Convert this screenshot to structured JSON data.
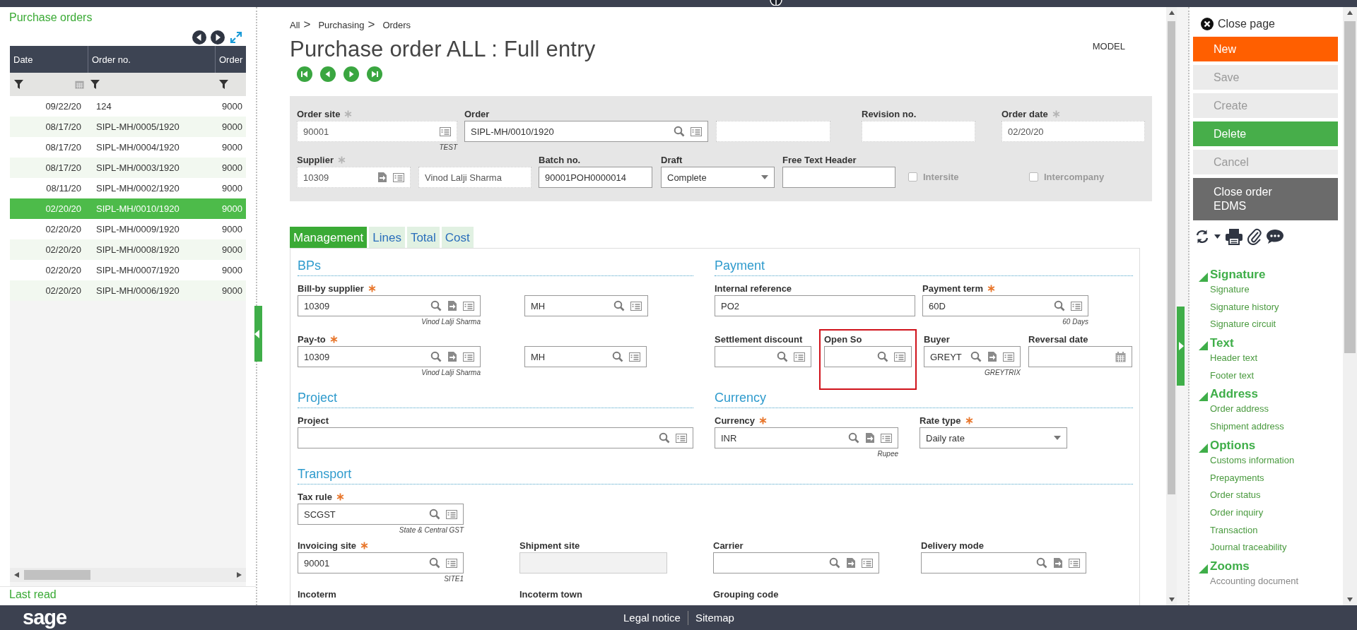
{
  "list_panel": {
    "title": "Purchase orders",
    "columns": [
      "Date",
      "Order no.",
      "Order"
    ],
    "rows": [
      {
        "date": "09/22/20",
        "order_no": "124",
        "column_3": "9000",
        "selected": false
      },
      {
        "date": "08/17/20",
        "order_no": "SIPL-MH/0005/1920",
        "column_3": "9000",
        "selected": false
      },
      {
        "date": "08/17/20",
        "order_no": "SIPL-MH/0004/1920",
        "column_3": "9000",
        "selected": false
      },
      {
        "date": "08/17/20",
        "order_no": "SIPL-MH/0003/1920",
        "column_3": "9000",
        "selected": false
      },
      {
        "date": "08/11/20",
        "order_no": "SIPL-MH/0002/1920",
        "column_3": "9000",
        "selected": false
      },
      {
        "date": "02/20/20",
        "order_no": "SIPL-MH/0010/1920",
        "column_3": "9000",
        "selected": true
      },
      {
        "date": "02/20/20",
        "order_no": "SIPL-MH/0009/1920",
        "column_3": "9000",
        "selected": false
      },
      {
        "date": "02/20/20",
        "order_no": "SIPL-MH/0008/1920",
        "column_3": "9000",
        "selected": false
      },
      {
        "date": "02/20/20",
        "order_no": "SIPL-MH/0007/1920",
        "column_3": "9000",
        "selected": false
      },
      {
        "date": "02/20/20",
        "order_no": "SIPL-MH/0006/1920",
        "column_3": "9000",
        "selected": false
      }
    ],
    "footer": "Last read"
  },
  "breadcrumb": [
    {
      "label": "All",
      "separator": ">"
    },
    {
      "label": "Purchasing",
      "separator": ">"
    },
    {
      "label": "Orders"
    }
  ],
  "page_title": "Purchase order ALL : Full entry",
  "mode_label": "MODEL",
  "header_rows": [
    [
      {
        "label": "Order site",
        "required": true,
        "value": "90001",
        "hint": "TEST",
        "kind": "detail",
        "readonly": true
      },
      {
        "label": "Order",
        "required": false,
        "value": "SIPL-MH/0010/1920",
        "kind": "lookup",
        "readonly": false
      },
      {
        "required": false,
        "kind": "text",
        "readonly": true
      },
      {
        "label": "Revision no.",
        "required": false,
        "kind": "text",
        "readonly": true
      },
      {
        "label": "Order date",
        "required": true,
        "value": "02/20/20",
        "kind": "text",
        "readonly": true
      }
    ],
    [
      {
        "label": "Supplier",
        "required": true,
        "value": "10309",
        "kind": "jump-detail",
        "readonly": true
      },
      {
        "required": false,
        "value": "Vinod Lalji Sharma",
        "kind": "text",
        "readonly": true
      },
      {
        "label": "Batch no.",
        "required": false,
        "value": "90001POH0000014",
        "kind": "text",
        "readonly": false
      },
      {
        "label": "Draft",
        "required": false,
        "value": "Complete",
        "kind": "select",
        "readonly": false
      },
      {
        "label": "Free Text Header",
        "required": false,
        "kind": "text",
        "readonly": false
      },
      {
        "label": "Intersite",
        "kind": "checkbox",
        "checked": false,
        "disabled": true
      },
      {
        "label": "Intercompany",
        "kind": "checkbox",
        "checked": false,
        "disabled": true
      }
    ]
  ],
  "tabs": [
    {
      "label": "Management",
      "selected": true
    },
    {
      "label": "Lines",
      "selected": false
    },
    {
      "label": "Total",
      "selected": false
    },
    {
      "label": "Cost",
      "selected": false
    }
  ],
  "sections": [
    {
      "title": "BPs",
      "rows": [
        [
          {
            "label": "Bill-by supplier",
            "required": true,
            "value": "10309",
            "hint": "Vinod Lalji Sharma",
            "kind": "lookup-jump"
          },
          {
            "value": "MH",
            "kind": "lookup"
          }
        ],
        [
          {
            "label": "Pay-to",
            "required": true,
            "value": "10309",
            "hint": "Vinod Lalji Sharma",
            "kind": "lookup-jump"
          },
          {
            "value": "MH",
            "kind": "lookup"
          }
        ]
      ]
    },
    {
      "title": "Payment",
      "rows": [
        [
          {
            "label": "Internal reference",
            "required": false,
            "value": "PO2",
            "kind": "text"
          },
          "",
          {
            "label": "Payment term",
            "required": true,
            "value": "60D",
            "hint": "60 Days",
            "kind": "lookup"
          }
        ],
        [
          {
            "label": "Settlement discount",
            "required": false,
            "kind": "lookup"
          },
          {
            "label": "Open So",
            "required": false,
            "kind": "lookup",
            "highlighted": true
          },
          {
            "label": "Buyer",
            "required": false,
            "value": "GREYT",
            "hint": "GREYTRIX",
            "kind": "lookup-jump"
          },
          {
            "label": "Reversal date",
            "required": false,
            "kind": "date"
          }
        ]
      ]
    },
    {
      "title": "Project",
      "rows": [
        [
          {
            "label": "Project",
            "required": false,
            "kind": "lookup"
          }
        ]
      ]
    },
    {
      "title": "Currency",
      "rows": [
        [
          {
            "label": "Currency",
            "required": true,
            "value": "INR",
            "hint": "Rupee",
            "kind": "lookup-jump"
          },
          {
            "label": "Rate type",
            "required": true,
            "value": "Daily rate",
            "kind": "select"
          }
        ]
      ]
    },
    {
      "title": "Transport",
      "rows": [
        [
          {
            "label": "Tax rule",
            "required": true,
            "value": "SCGST",
            "hint": "State & Central GST",
            "kind": "lookup"
          }
        ],
        [
          {
            "label": "Invoicing site",
            "required": true,
            "value": "90001",
            "hint": "SITE1",
            "kind": "lookup"
          },
          {
            "label": "Shipment site",
            "required": false,
            "kind": "text",
            "disabled": true
          },
          {
            "label": "Carrier",
            "required": false,
            "kind": "lookup-jump"
          },
          {
            "label": "Delivery mode",
            "required": false,
            "kind": "lookup-jump"
          }
        ],
        [
          {
            "label": "Incoterm",
            "required": false
          },
          {
            "label": "Incoterm town",
            "required": false
          },
          {
            "label": "Grouping code",
            "required": false
          }
        ]
      ]
    }
  ],
  "actions": {
    "close_label": "Close page",
    "buttons": [
      {
        "lines": [
          "New"
        ],
        "kind": "primary",
        "disabled": false
      },
      {
        "lines": [
          "Save"
        ],
        "kind": "plain",
        "disabled": true
      },
      {
        "lines": [
          "Create"
        ],
        "kind": "plain",
        "disabled": true
      },
      {
        "lines": [
          "Delete"
        ],
        "kind": "success",
        "disabled": false
      },
      {
        "lines": [
          "Cancel"
        ],
        "kind": "plain",
        "disabled": true
      },
      {
        "lines": [
          "Close order",
          "EDMS"
        ],
        "kind": "dark",
        "disabled": false
      }
    ]
  },
  "menu": [
    {
      "title": "Signature",
      "expanded": true,
      "items": [
        {
          "label": "Signature",
          "disabled": false
        },
        {
          "label": "Signature history",
          "disabled": false
        },
        {
          "label": "Signature circuit",
          "disabled": false
        }
      ]
    },
    {
      "title": "Text",
      "expanded": true,
      "items": [
        {
          "label": "Header text",
          "disabled": false
        },
        {
          "label": "Footer text",
          "disabled": false
        }
      ]
    },
    {
      "title": "Address",
      "expanded": true,
      "items": [
        {
          "label": "Order address",
          "disabled": false
        },
        {
          "label": "Shipment address",
          "disabled": false
        }
      ]
    },
    {
      "title": "Options",
      "expanded": true,
      "items": [
        {
          "label": "Customs information",
          "disabled": false
        },
        {
          "label": "Prepayments",
          "disabled": false
        },
        {
          "label": "Order status",
          "disabled": false
        },
        {
          "label": "Order inquiry",
          "disabled": false
        },
        {
          "label": "Transaction",
          "disabled": false
        },
        {
          "label": "Journal traceability",
          "disabled": false
        }
      ]
    },
    {
      "title": "Zooms",
      "expanded": true,
      "items": [
        {
          "label": "Accounting document",
          "disabled": true
        }
      ]
    }
  ],
  "footer": {
    "logo": "sage",
    "links": [
      "Legal notice",
      "Sitemap"
    ]
  }
}
